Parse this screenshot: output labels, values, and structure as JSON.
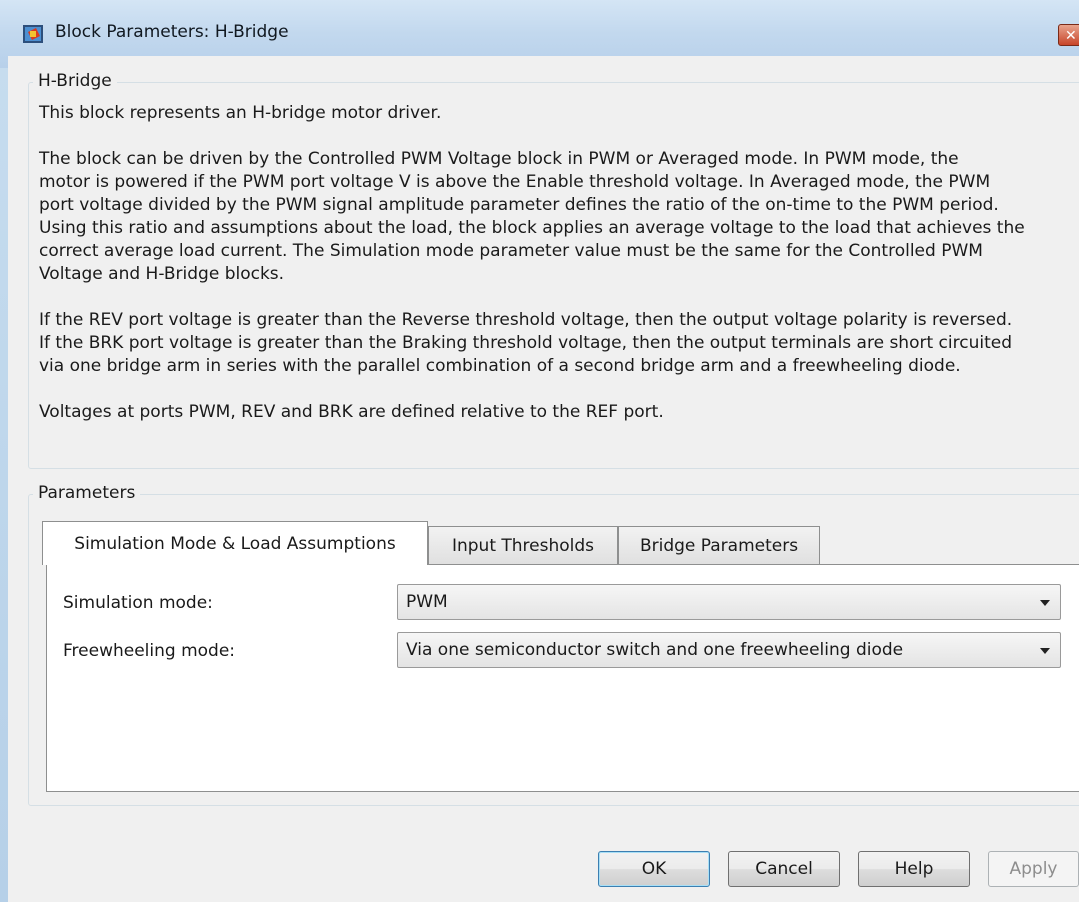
{
  "window": {
    "title": "Block Parameters: H-Bridge",
    "close_glyph": "✕"
  },
  "block_group": {
    "legend": "H-Bridge",
    "description": [
      "This block represents an H-bridge motor driver.",
      "",
      "The block can be driven by the Controlled PWM Voltage block in PWM or Averaged mode. In PWM mode, the",
      "motor is powered if the PWM port voltage V is above the Enable threshold voltage. In Averaged mode, the PWM",
      "port voltage divided by the PWM signal amplitude parameter defines the ratio of the on-time to the PWM period.",
      "Using this ratio and assumptions about the load, the block applies an average voltage to the load that achieves the",
      "correct average load current. The Simulation mode parameter value must be the same for the Controlled PWM",
      "Voltage and H-Bridge blocks.",
      "",
      "If the REV port voltage is greater than the Reverse threshold voltage, then the output voltage polarity is reversed.",
      "If the BRK port voltage is greater than the Braking threshold voltage, then the output terminals are short circuited",
      "via one bridge arm in series with the parallel combination of a second bridge arm and a freewheeling diode.",
      "",
      "Voltages at ports PWM, REV and BRK are defined relative to the REF port."
    ]
  },
  "parameters_group": {
    "legend": "Parameters",
    "tabs": [
      {
        "label": "Simulation Mode & Load Assumptions",
        "active": true
      },
      {
        "label": "Input Thresholds",
        "active": false
      },
      {
        "label": "Bridge Parameters",
        "active": false
      }
    ],
    "fields": [
      {
        "label": "Simulation mode:",
        "value": "PWM"
      },
      {
        "label": "Freewheeling mode:",
        "value": "Via one semiconductor switch and one freewheeling diode"
      }
    ]
  },
  "buttons": {
    "ok": "OK",
    "cancel": "Cancel",
    "help": "Help",
    "apply": "Apply"
  },
  "icons": {
    "app": "simulink-block-icon",
    "dropdown": "chevron-down-icon"
  }
}
